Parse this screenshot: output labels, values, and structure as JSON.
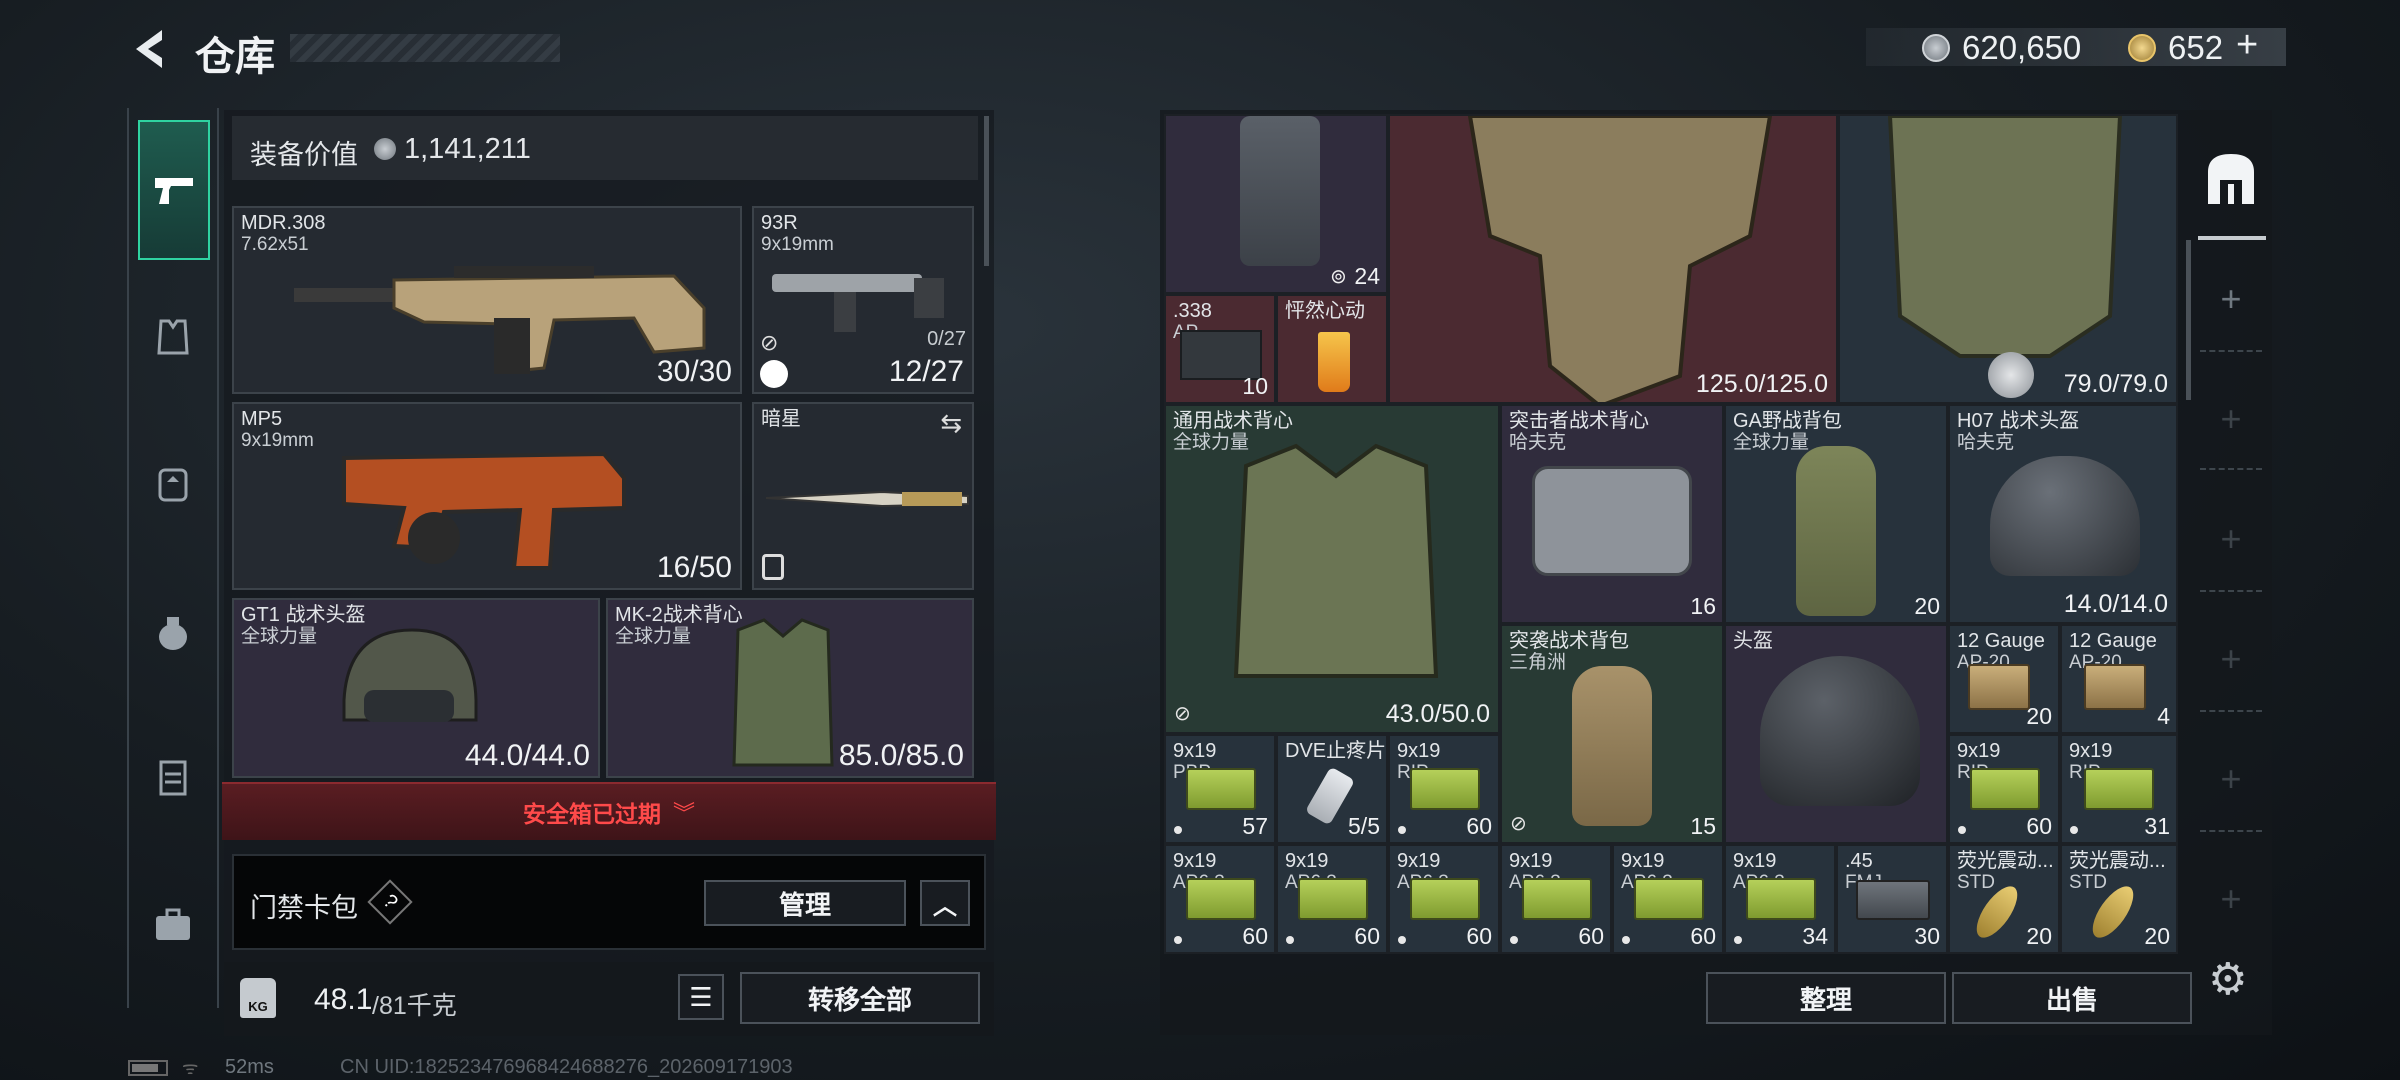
{
  "header": {
    "title": "仓库",
    "currency1": "620,650",
    "currency2": "652",
    "plus": "+"
  },
  "sidebar": {
    "items": [
      "pistol-icon",
      "armor-icon",
      "backpack-icon",
      "bag-icon",
      "chest-rig-icon",
      "briefcase-icon"
    ]
  },
  "equipment": {
    "value_label": "装备价值",
    "value": "1,141,211",
    "slots": [
      {
        "name": "MDR.308",
        "sub": "7.62x51",
        "count": "30/30"
      },
      {
        "name": "93R",
        "sub": "9x19mm",
        "count_small": "0/27",
        "count": "12/27"
      },
      {
        "name": "MP5",
        "sub": "9x19mm",
        "count": "16/50"
      },
      {
        "name": "暗星",
        "sub": ""
      },
      {
        "name": "GT1 战术头盔",
        "sub": "全球力量",
        "count": "44.0/44.0"
      },
      {
        "name": "MK-2战术背心",
        "sub": "全球力量",
        "count": "85.0/85.0"
      }
    ],
    "safe_box": "安全箱已过期",
    "keycard": "门禁卡包",
    "help": "?",
    "manage": "管理",
    "weight": "48.1",
    "weight_max": "/81千克",
    "transfer": "转移全部",
    "ping": "52ms",
    "uid": "CN UID:18252347696842468827​6_202609171903"
  },
  "stash": {
    "items": [
      {
        "n1": "",
        "n2": "",
        "q": "24"
      },
      {
        "n1": "",
        "n2": "",
        "q": "125.0/125.0"
      },
      {
        "n1": "",
        "n2": "",
        "q": "79.0/79.0"
      },
      {
        "n1": ".338",
        "n2": "AP",
        "q": "10"
      },
      {
        "n1": "怦然心动",
        "n2": "",
        "q": ""
      },
      {
        "n1": "通用战术背心",
        "n2": "全球力量",
        "q": "43.0/50.0"
      },
      {
        "n1": "突击者战术背心",
        "n2": "哈夫克",
        "q": "16"
      },
      {
        "n1": "GA野战背包",
        "n2": "全球力量",
        "q": "20"
      },
      {
        "n1": "H07 战术头盔",
        "n2": "哈夫克",
        "q": "14.0/14.0"
      },
      {
        "n1": "突袭战术背包",
        "n2": "三角洲",
        "q": "15"
      },
      {
        "n1": "头盔",
        "n2": "",
        "q": ""
      },
      {
        "n1": "12 Gauge",
        "n2": "AP-20",
        "q": "20"
      },
      {
        "n1": "12 Gauge",
        "n2": "AP-20",
        "q": "4"
      },
      {
        "n1": "9x19",
        "n2": "PBP",
        "q": "57"
      },
      {
        "n1": "DVE止疼片",
        "n2": "",
        "q": "5/5"
      },
      {
        "n1": "9x19",
        "n2": "RIP",
        "q": "60"
      },
      {
        "n1": "9x19",
        "n2": "RIP",
        "q": "60"
      },
      {
        "n1": "9x19",
        "n2": "RIP",
        "q": "31"
      },
      {
        "n1": "9x19",
        "n2": "AP6.3",
        "q": "60"
      },
      {
        "n1": "9x19",
        "n2": "AP6.3",
        "q": "60"
      },
      {
        "n1": "9x19",
        "n2": "AP6.3",
        "q": "60"
      },
      {
        "n1": "9x19",
        "n2": "AP6.3",
        "q": "60"
      },
      {
        "n1": "9x19",
        "n2": "AP6.3",
        "q": "60"
      },
      {
        "n1": "9x19",
        "n2": "AP6.3",
        "q": "34"
      },
      {
        "n1": ".45",
        "n2": "FMJ",
        "q": "30"
      },
      {
        "n1": "荧光震动...",
        "n2": "STD",
        "q": "20"
      },
      {
        "n1": "荧光震动...",
        "n2": "STD",
        "q": "20"
      }
    ],
    "sort": "整理",
    "sell": "出售"
  },
  "colors": {
    "accent_green": "#2fd3a1",
    "alert_red": "#ff3b3b",
    "panel": "#1e2329"
  }
}
